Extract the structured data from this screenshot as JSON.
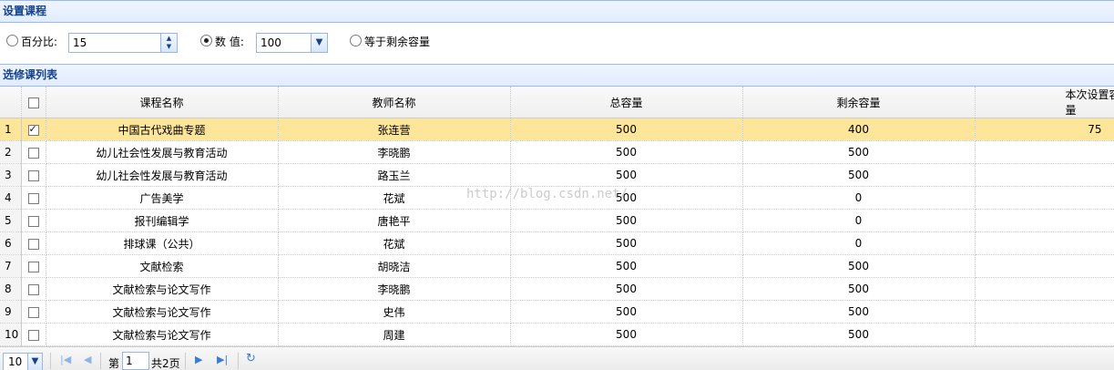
{
  "panels": {
    "settings_title": "设置课程",
    "list_title": "选修课列表"
  },
  "settings": {
    "percent_label": "百分比:",
    "percent_value": "15",
    "number_label": "数 值:",
    "number_value": "100",
    "remaining_label": "等于剩余容量",
    "selected_mode": "number"
  },
  "table": {
    "columns": [
      "课程名称",
      "教师名称",
      "总容量",
      "剩余容量",
      "本次设置容量"
    ],
    "rows": [
      {
        "no": "1",
        "checked": true,
        "course": "中国古代戏曲专题",
        "teacher": "张连营",
        "total": "500",
        "remaining": "400",
        "set": "75"
      },
      {
        "no": "2",
        "checked": false,
        "course": "幼儿社会性发展与教育活动",
        "teacher": "李晓鹏",
        "total": "500",
        "remaining": "500",
        "set": ""
      },
      {
        "no": "3",
        "checked": false,
        "course": "幼儿社会性发展与教育活动",
        "teacher": "路玉兰",
        "total": "500",
        "remaining": "500",
        "set": ""
      },
      {
        "no": "4",
        "checked": false,
        "course": "广告美学",
        "teacher": "花斌",
        "total": "500",
        "remaining": "0",
        "set": ""
      },
      {
        "no": "5",
        "checked": false,
        "course": "报刊编辑学",
        "teacher": "唐艳平",
        "total": "500",
        "remaining": "0",
        "set": ""
      },
      {
        "no": "6",
        "checked": false,
        "course": "排球课（公共）",
        "teacher": "花斌",
        "total": "500",
        "remaining": "0",
        "set": ""
      },
      {
        "no": "7",
        "checked": false,
        "course": "文献检索",
        "teacher": "胡晓洁",
        "total": "500",
        "remaining": "500",
        "set": ""
      },
      {
        "no": "8",
        "checked": false,
        "course": "文献检索与论文写作",
        "teacher": "李晓鹏",
        "total": "500",
        "remaining": "500",
        "set": ""
      },
      {
        "no": "9",
        "checked": false,
        "course": "文献检索与论文写作",
        "teacher": "史伟",
        "total": "500",
        "remaining": "500",
        "set": ""
      },
      {
        "no": "10",
        "checked": false,
        "course": "文献检索与论文写作",
        "teacher": "周建",
        "total": "500",
        "remaining": "500",
        "set": ""
      }
    ]
  },
  "watermark": "http://blog.csdn.net/",
  "pager": {
    "page_size": "10",
    "page_prefix": "第",
    "page_current": "1",
    "page_total": "共2页"
  },
  "icons": {
    "first": "first-page-icon",
    "prev": "prev-page-icon",
    "next": "next-page-icon",
    "last": "last-page-icon",
    "refresh": "refresh-icon"
  },
  "colors": {
    "header_text": "#15428b",
    "selected_row": "#fde59a",
    "border": "#99bbe8"
  }
}
